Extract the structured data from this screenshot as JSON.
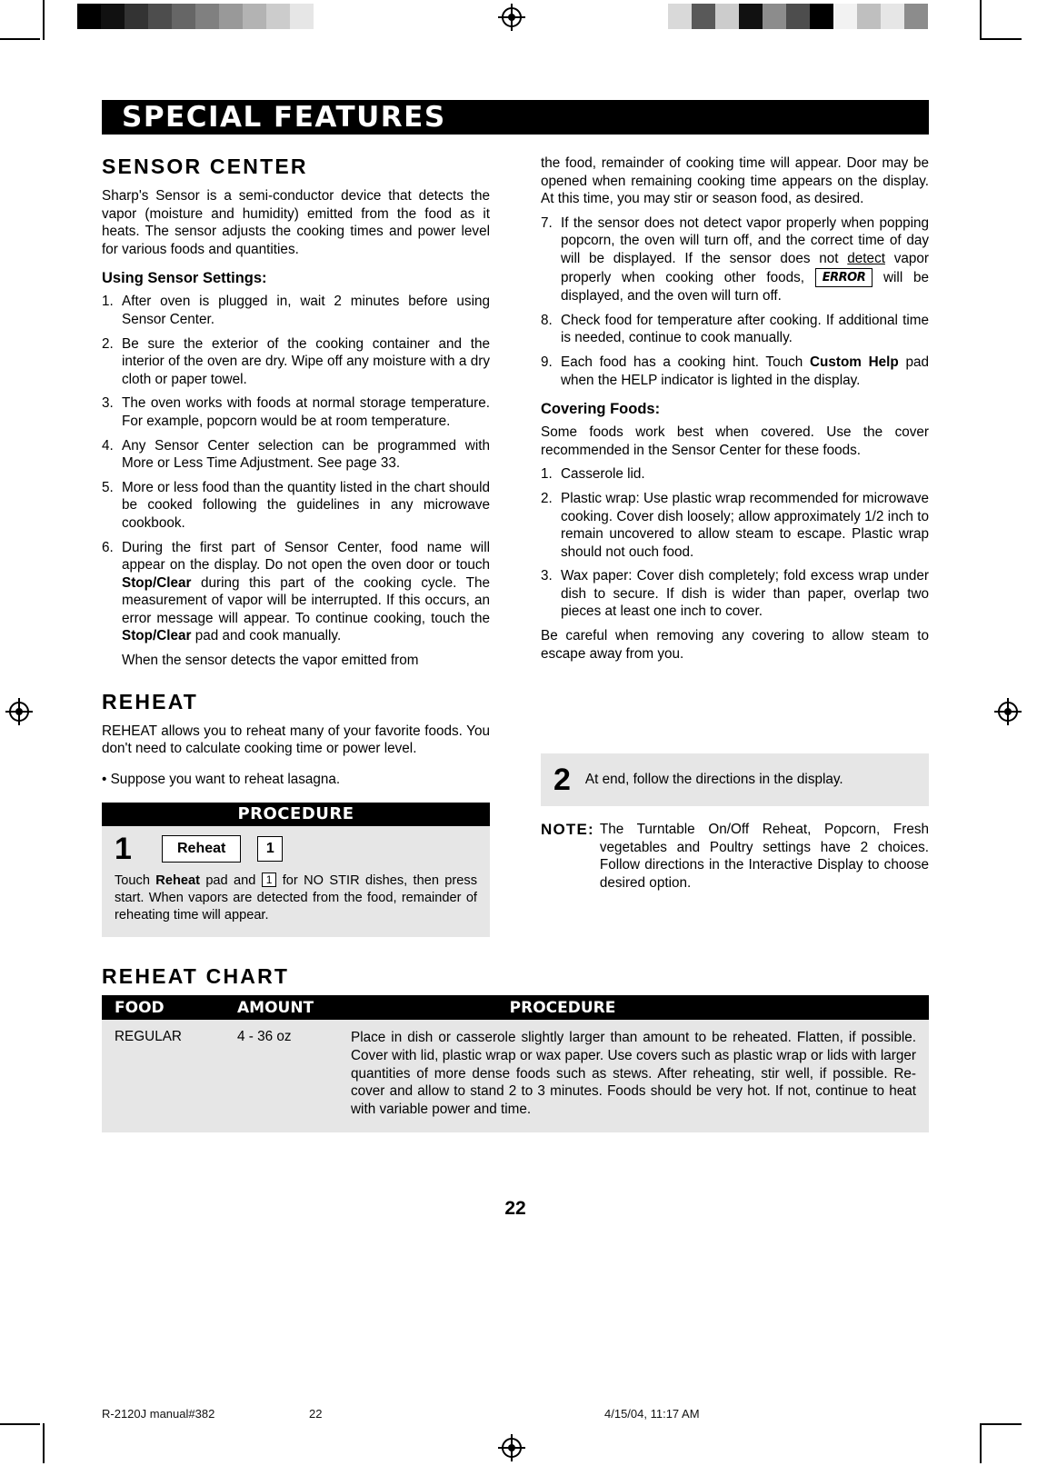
{
  "banner": {
    "title": "SPECIAL FEATURES"
  },
  "left": {
    "sensor": {
      "heading": "SENSOR CENTER",
      "intro": "Sharp's Sensor is a semi-conductor device that detects the vapor (moisture and humidity) emitted from the food as it heats. The sensor adjusts the cooking times and power level for various foods and quantities.",
      "sub_heading": "Using Sensor Settings:",
      "items": [
        {
          "num": "1.",
          "text": "After oven is plugged in, wait 2 minutes before using Sensor Center."
        },
        {
          "num": "2.",
          "text": "Be sure the exterior of the cooking container and the interior of the oven are dry. Wipe off any moisture with a dry cloth or paper towel."
        },
        {
          "num": "3.",
          "text": "The oven works with foods at normal storage temperature. For example, popcorn would be at room temperature."
        },
        {
          "num": "4.",
          "text": "Any Sensor Center selection can be programmed with More or Less Time Adjustment. See page 33."
        },
        {
          "num": "5.",
          "text": "More or less food than the quantity listed in the chart should be cooked following the guidelines in any microwave cookbook."
        }
      ],
      "item6": {
        "num": "6.",
        "part1": "During the first part of Sensor Center, food name will appear on the display. Do not open the oven door or touch ",
        "bold1": "Stop/Clear",
        "part2": " during this part of the cooking cycle. The measurement of vapor will be interrupted. If this occurs, an error message will appear. To continue cooking, touch the ",
        "bold2": "Stop/Clear",
        "part3": " pad and cook manually."
      },
      "item6_trailing": "When the sensor detects the vapor emitted from"
    },
    "reheat": {
      "heading": "REHEAT",
      "intro": "REHEAT allows you to reheat many of your favorite foods. You don't need to calculate cooking time or power level.",
      "bullet": "•  Suppose you want to reheat lasagna."
    },
    "procedure": {
      "header": "PROCEDURE",
      "step_number": "1",
      "pad_label": "Reheat",
      "pad_small_label": "1",
      "text_part1": "Touch ",
      "text_bold": "Reheat",
      "text_part2": " pad and ",
      "text_key": "1",
      "text_part3": " for NO STIR dishes, then press start. When vapors are detected from the food, remainder of reheating time will appear."
    }
  },
  "right": {
    "continued": "the food, remainder of cooking time will appear. Door may be opened when remaining cooking time appears on the display. At this time, you may stir or season food, as desired.",
    "items": [
      {
        "num": "7.",
        "part1": "If the sensor does not detect vapor properly when popping popcorn, the oven will turn off, and the correct time of day will be displayed. If the sensor does not ",
        "underline": "detect",
        "part2": " vapor properly when cooking other foods, ",
        "error_box": "ERROR",
        "part3": " will be displayed, and the oven will turn off."
      },
      {
        "num": "8.",
        "text": "Check food for temperature after cooking. If additional time is needed, continue to cook manually."
      },
      {
        "num": "9.",
        "part1": "Each food has a cooking hint. Touch ",
        "bold": "Custom Help",
        "part2": " pad when the HELP indicator is lighted in the display."
      }
    ],
    "covering": {
      "heading": "Covering Foods:",
      "intro": "Some foods work best when covered. Use the cover recommended in the Sensor Center for these foods.",
      "items": [
        {
          "num": "1.",
          "text": "Casserole lid."
        },
        {
          "num": "2.",
          "text": "Plastic wrap: Use plastic wrap recommended for microwave cooking. Cover dish loosely; allow  approximately 1/2 inch to remain uncovered to allow steam to escape. Plastic wrap should not ouch food."
        },
        {
          "num": "3.",
          "text": "Wax paper: Cover dish completely; fold excess wrap under dish to secure. If dish is wider than paper, overlap two pieces at least one inch to cover."
        }
      ],
      "closing": "Be careful when removing any covering to allow steam to escape away from you."
    },
    "step2": {
      "number": "2",
      "text": "At end, follow the directions in the display."
    },
    "note": {
      "label": "NOTE:",
      "text": "The Turntable On/Off Reheat, Popcorn, Fresh vegetables and Poultry settings have 2 choices. Follow directions in the Interactive Display to choose desired option."
    }
  },
  "chart": {
    "title": "REHEAT CHART",
    "columns": [
      "FOOD",
      "AMOUNT",
      "PROCEDURE"
    ],
    "rows": [
      {
        "food": "REGULAR",
        "amount": "4 - 36 oz",
        "procedure": "Place in dish or casserole slightly larger than amount to be reheated. Flatten, if possible. Cover with lid, plastic wrap or wax paper. Use covers such as plastic wrap or lids with larger quantities of more dense foods such as stews. After reheating, stir well, if possible. Re-cover and allow to stand 2 to 3 minutes. Foods should be very hot. If not, continue to heat with variable power and time."
      }
    ]
  },
  "page_number": "22",
  "footer": {
    "file": "R-2120J manual#382",
    "page": "22",
    "timestamp": "4/15/04, 11:17 AM"
  },
  "colors": {
    "banner_bg": "#000000",
    "panel_bg": "#e6e6e6",
    "text": "#000000"
  }
}
